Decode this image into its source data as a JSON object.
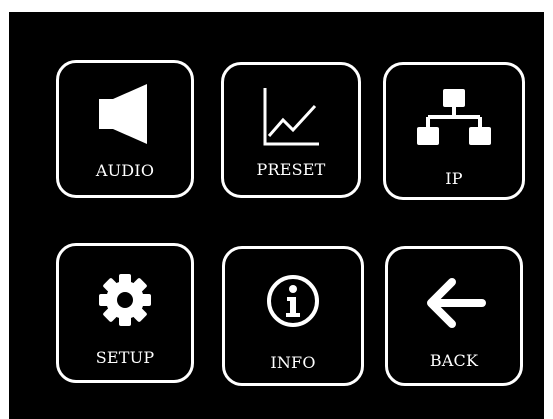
{
  "colors": {
    "screen_background": "#000000",
    "foreground": "#ffffff"
  },
  "menu": {
    "audio": {
      "label": "AUDIO",
      "icon": "speaker-icon"
    },
    "preset": {
      "label": "PRESET",
      "icon": "line-chart-icon"
    },
    "ip": {
      "label": "IP",
      "icon": "network-icon"
    },
    "setup": {
      "label": "SETUP",
      "icon": "gear-icon"
    },
    "info": {
      "label": "INFO",
      "icon": "info-icon"
    },
    "back": {
      "label": "BACK",
      "icon": "arrow-left-icon"
    }
  }
}
